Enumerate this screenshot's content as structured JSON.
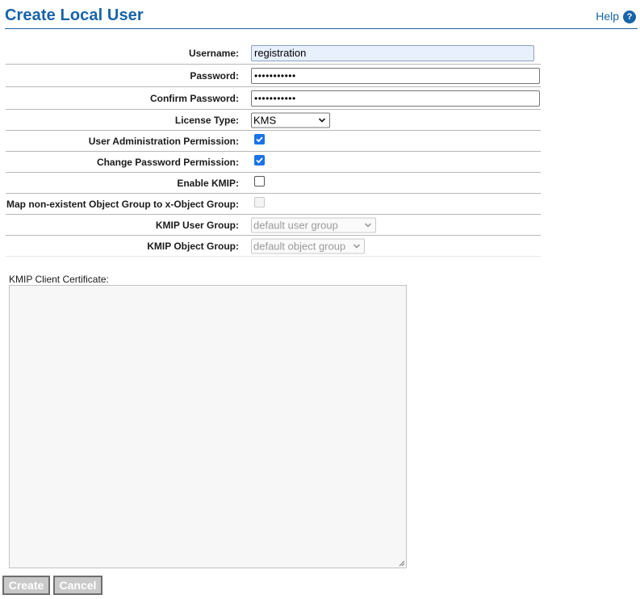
{
  "header": {
    "title": "Create Local User",
    "help_label": "Help",
    "help_icon": "question-circle-icon",
    "accent_color": "#1764a8"
  },
  "form": {
    "username": {
      "label": "Username:",
      "value": "registration"
    },
    "password": {
      "label": "Password:",
      "value": "•••••••••••"
    },
    "confirm_password": {
      "label": "Confirm Password:",
      "value": "•••••••••••"
    },
    "license_type": {
      "label": "License Type:",
      "value": "KMS"
    },
    "user_admin_permission": {
      "label": "User Administration Permission:",
      "checked": true
    },
    "change_password_permission": {
      "label": "Change Password Permission:",
      "checked": true
    },
    "enable_kmip": {
      "label": "Enable KMIP:",
      "checked": false
    },
    "map_object_group": {
      "label": "Map non-existent Object Group to x-Object Group:",
      "checked": false,
      "disabled": true
    },
    "kmip_user_group": {
      "label": "KMIP User Group:",
      "value": "default user group",
      "disabled": true
    },
    "kmip_object_group": {
      "label": "KMIP Object Group:",
      "value": "default object group",
      "disabled": true
    }
  },
  "certificate": {
    "label": "KMIP Client Certificate:",
    "value": ""
  },
  "actions": {
    "create_label": "Create",
    "cancel_label": "Cancel"
  }
}
